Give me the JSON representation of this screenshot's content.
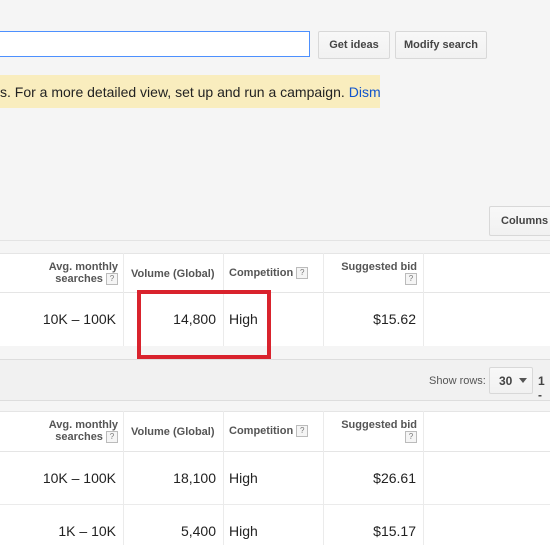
{
  "toolbar": {
    "get_ideas_label": "Get ideas",
    "modify_search_label": "Modify search"
  },
  "notice": {
    "text": "s. For a more detailed view, set up and run a campaign.",
    "dismiss_label": "Dismiss"
  },
  "columns_button_label": "Columns",
  "headers": {
    "avg_monthly": "Avg. monthly searches",
    "volume_global": "Volume (Global)",
    "competition": "Competition",
    "suggested_bid": "Suggested bid",
    "help_glyph": "?"
  },
  "table1": {
    "rows": [
      {
        "avg": "10K – 100K",
        "volume": "14,800",
        "competition": "High",
        "bid": "$15.62"
      }
    ]
  },
  "pager": {
    "show_rows_label": "Show rows:",
    "rows_value": "30",
    "range_text": "1 -"
  },
  "table2": {
    "rows": [
      {
        "avg": "10K – 100K",
        "volume": "18,100",
        "competition": "High",
        "bid": "$26.61"
      },
      {
        "avg": "1K – 10K",
        "volume": "5,400",
        "competition": "High",
        "bid": "$15.17"
      }
    ]
  },
  "colors": {
    "highlight": "#d9232d",
    "link": "#1155cc",
    "notice_bg": "#f9edbe"
  }
}
